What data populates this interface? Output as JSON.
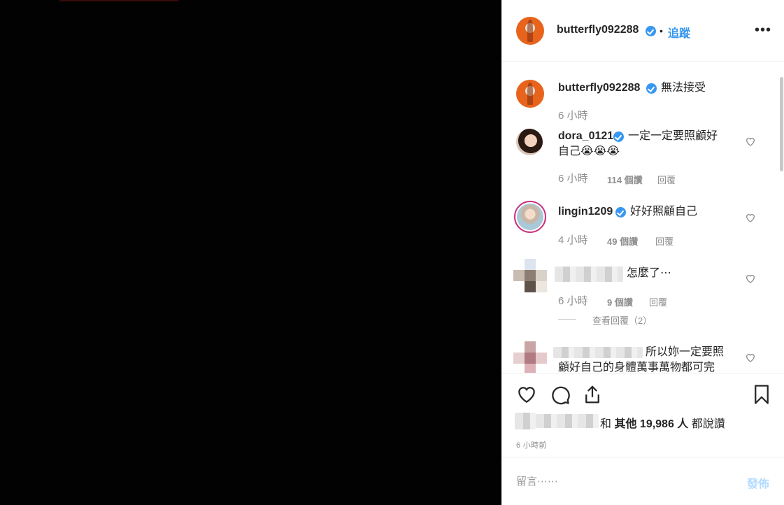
{
  "header": {
    "username": "butterfly092288",
    "separator": "•",
    "follow_label": "追蹤",
    "more_label": "•••"
  },
  "caption": {
    "username": "butterfly092288",
    "text": "無法接受",
    "time": "6 小時"
  },
  "comments": [
    {
      "username": "dora_0121",
      "text_line1": "一定一定要照顧好",
      "text_line2": "自己😭😭😭",
      "time": "6 小時",
      "likes": "114 個讚",
      "reply": "回覆"
    },
    {
      "username": "lingin1209",
      "text": "好好照顧自己",
      "time": "4 小時",
      "likes": "49 個讚",
      "reply": "回覆"
    },
    {
      "text": "怎麼了⋯",
      "time": "6 小時",
      "likes": "9 個讚",
      "reply": "回覆",
      "view_replies": "查看回覆（2）",
      "view_replies_dash": "——"
    },
    {
      "text_line1": "所以妳一定要照",
      "text_line2": "顧好自己的身體萬事萬物都可完"
    }
  ],
  "likes_summary": {
    "conj": "和",
    "others": "其他 19,986 人",
    "suffix": "都說讚"
  },
  "post_time": "6 小時前",
  "composer": {
    "placeholder": "留言⋯⋯",
    "post_label": "發佈"
  },
  "colors": {
    "accent": "#3897f0",
    "post_disabled": "#b3dbff"
  }
}
